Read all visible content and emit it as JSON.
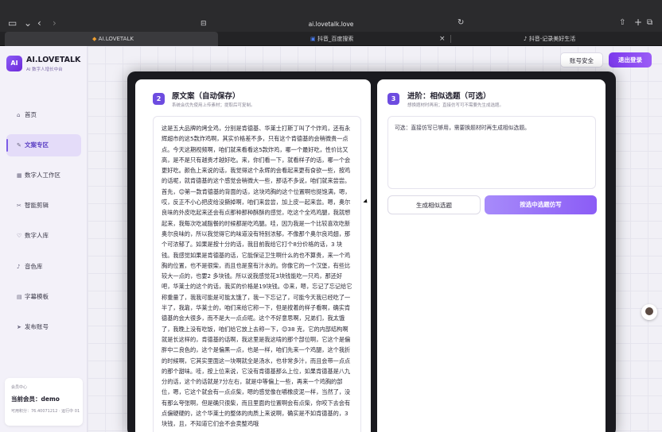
{
  "browser": {
    "url": "ai.lovetalk.love",
    "tabs": [
      {
        "label": "AI.LOVETALK",
        "active": true
      },
      {
        "label": "抖音_百度搜索",
        "active": false
      },
      {
        "label": "抖音-记录美好生活",
        "active": false
      }
    ]
  },
  "app": {
    "logo_mark": "AI",
    "title": "AI.LOVETALK",
    "subtitle": "AI 数字人增长中台"
  },
  "sidebar": {
    "items": [
      {
        "icon": "home-icon",
        "glyph": "⌂",
        "label": "首页",
        "active": false
      },
      {
        "icon": "document-icon",
        "glyph": "✎",
        "label": "文案专区",
        "active": true
      },
      {
        "icon": "grid-icon",
        "glyph": "▦",
        "label": "数字人工作区",
        "active": false
      },
      {
        "icon": "scissors-icon",
        "glyph": "✂",
        "label": "智能剪辑",
        "active": false
      },
      {
        "icon": "heart-icon",
        "glyph": "♡",
        "label": "数字人库",
        "active": false
      },
      {
        "icon": "music-icon",
        "glyph": "♪",
        "label": "音色库",
        "active": false
      },
      {
        "icon": "subtitle-icon",
        "glyph": "▤",
        "label": "字幕模板",
        "active": false
      },
      {
        "icon": "send-icon",
        "glyph": "➤",
        "label": "发布账号",
        "active": false
      }
    ]
  },
  "member": {
    "caption": "会员中心",
    "label": "当前会员：demo",
    "meta": "可用积分：76.40071212 · 运行中 01"
  },
  "header": {
    "account_button": "账号安全",
    "logout_button": "退出登录"
  },
  "left_panel": {
    "step": "2",
    "title": "原文案（自动保存）",
    "subtitle": "系统会优先使用上传素材；提取后可复制。",
    "body": "这是五大品牌的烤全鸡，分别是肯德基、华莱士打斯丁叫了个炸鸡，还有永辉超市的这5款炸鸡啊，其实价格差不多，只有这个肯德基的会稍微贵一点点。今天这期视频啊，咱们就来看看这5款炸鸡，哪一个最好吃，性价比又高，是不是只有越贵才越好吃。来，你们看一下，就看样子的话，哪一个会更好吃。颜色上来说的话，我觉得这个永辉的会看起来更有食欲一些，按鸡的话呢，就肯德基的这个感觉会稍微大一些，那话不多说，咱们就来尝尝。首先，😊第一款肯德基的背面的话，这块鸡胸的这个位置啊也挺饱满，嗯，哎，反正不小心把皮给没撕掉啊，咱们来尝尝，加上皮一起来尝。嗯，奥尔良味的外皮吃起来还会有点那种那种酥酥的感觉，吃这个全鸡鸡腿，我就想起来，我每次吃减脂餐的时候都是吃鸡腿。哇，因为我是一个比较喜欢吃新奥尔良味的，所以我觉得它的味道没有特别浓郁，不像那个奥尔良鸡翅，那个可浓郁了。如果是按十分的话，我目前我给它打个8分价格的话，3 块钱。我感觉如果是肯德基的话，它能保证卫生啊什么的也不算贵，来一个鸡胸的位置，也不是很柴，而且也是蛮有汁水的。你像它的一个汉堡，有些比较大一点的，也要2 多块钱。所以说我感觉花3块钱能吃一只鸡，那还好吧，华莱士的这个的话，我买的价格是19块钱。😡来，嗯，忘记了忘记给它称重量了，我我可能是可能太饿了，我一下忘记了，可能今天我已经吃了一半了，我靠，华莱士的，咱们来给它称一下，但是按着的样子看啊，确实肯德基的会大很多，而不是大一点点呢。这个不好意思啊，兄弟们，我太饿了，我晚上没有吃饭，咱们给它放上去称一下，😊38 克，它的内部结构啊就是长这样的，肯德基的话啊，我这里是我这啃的那个部位啊，它这个是偏胖中二良色的，这个是偏黑一点，也是一样，咱们先来一个鸡腿，这个我折的时候啊，它其实里面这一块啊就全是汤水，也非常多汁，而且会带一点点的那个甜味。哇，按上位来说，它没有肯德基那么上位，如果肯德基是八九分的话，这个的话就是7分左右，就是中等偏上一些，再来一个鸡胸的部位，嗯，它这个就会有一点点柴，嗯的感觉像在嚼橡皮泥一样，当然了，没有那么夸张啊，但是确只很柴，而且里面的位置啊会有点柴，你咬下去会有点偏硬硬的，这个华莱士的整体的肉质上来说啊，确实是不如肯德基的，3 块钱，且，不知道它们会不会卖整鸡哦"
  },
  "right_panel": {
    "step": "3",
    "title": "进阶：相似选题（可选）",
    "subtitle": "想换题材时再用；直接仿写可不需要先生成选题。",
    "hint": "可选：直接仿写已够用，需要换题材时再生成相似选题。",
    "generate_button": "生成相似选题",
    "rewrite_button": "按选中选题仿写"
  },
  "colors": {
    "accent": "#6d4ce0",
    "accent_light": "#a78bfa",
    "sidebar_active_bg": "#e4dcf9"
  }
}
